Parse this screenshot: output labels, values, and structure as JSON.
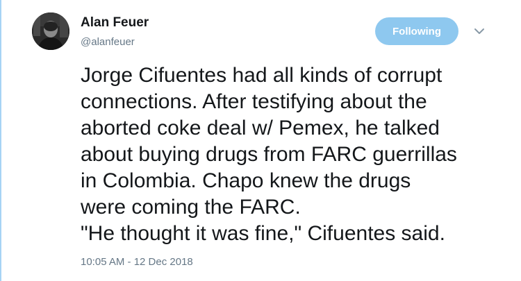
{
  "author": {
    "display_name": "Alan Feuer",
    "username": "@alanfeuer",
    "avatar_icon": "profile-photo"
  },
  "follow_button": {
    "label": "Following",
    "color": "#8ec8ef"
  },
  "menu": {
    "icon": "chevron-down-icon"
  },
  "tweet": {
    "lines": [
      "Jorge Cifuentes had all kinds of corrupt",
      "connections. After testifying about the",
      "aborted coke deal w/ Pemex, he talked",
      "about buying drugs from FARC guerrillas",
      "in Colombia. Chapo knew the drugs",
      "were coming the FARC.",
      "\"He thought it was fine,\" Cifuentes said."
    ],
    "timestamp": "10:05 AM - 12 Dec 2018"
  },
  "colors": {
    "thread_line": "#a7d3f5",
    "secondary_text": "#657786",
    "primary_text": "#14171a"
  }
}
